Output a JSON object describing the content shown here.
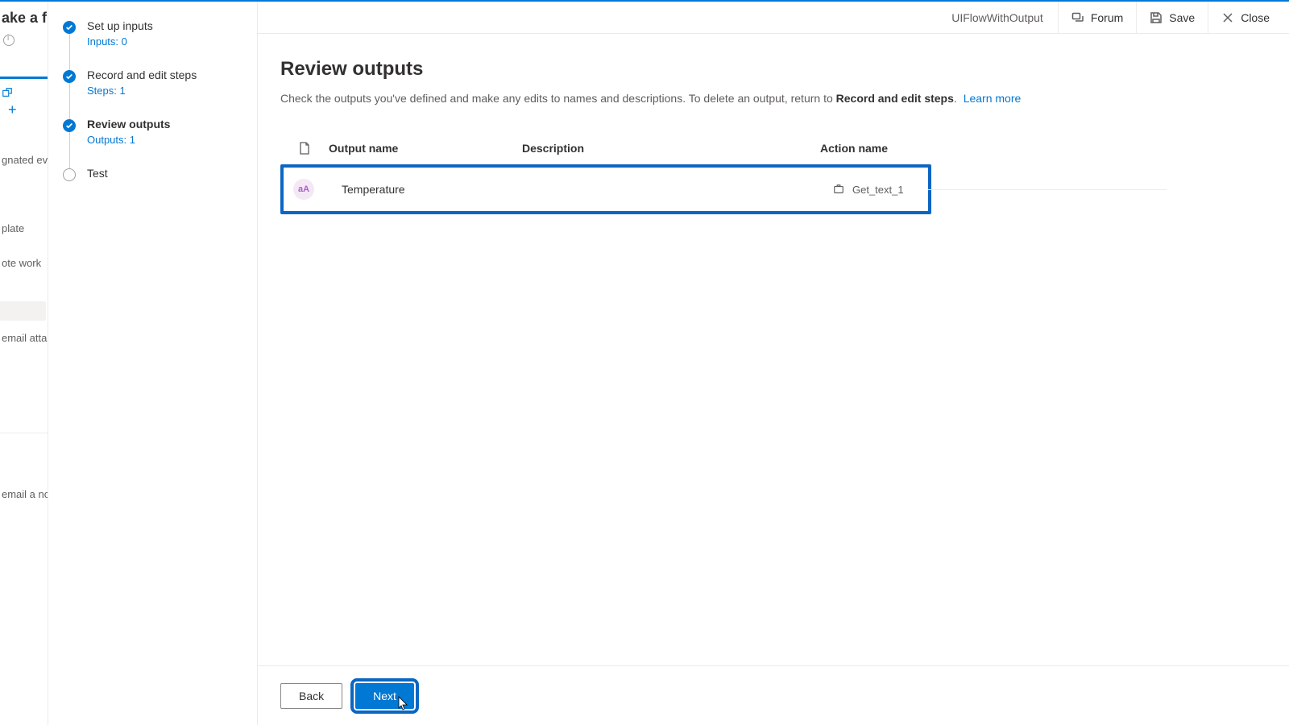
{
  "ghost": {
    "title": "ake a flo",
    "text1": "gnated even",
    "text2": "plate",
    "text3": "ote work",
    "text4": "email attac",
    "text5": "email a no"
  },
  "steps": [
    {
      "title": "Set up inputs",
      "sub": "Inputs: 0",
      "done": true
    },
    {
      "title": "Record and edit steps",
      "sub": "Steps: 1",
      "done": true
    },
    {
      "title": "Review outputs",
      "sub": "Outputs: 1",
      "done": true,
      "current": true
    },
    {
      "title": "Test",
      "sub": "",
      "done": false
    }
  ],
  "header": {
    "flow_name": "UIFlowWithOutput",
    "forum": "Forum",
    "save": "Save",
    "close": "Close"
  },
  "page": {
    "heading": "Review outputs",
    "desc_pre": "Check the outputs you've defined and make any edits to names and descriptions. To delete an output, return to ",
    "desc_bold": "Record and edit steps",
    "desc_post": ".",
    "learn_more": "Learn more"
  },
  "table": {
    "col_output": "Output name",
    "col_desc": "Description",
    "col_action": "Action name",
    "rows": [
      {
        "type_badge": "aA",
        "name": "Temperature",
        "description": "",
        "action": "Get_text_1"
      }
    ]
  },
  "footer": {
    "back": "Back",
    "next": "Next"
  }
}
